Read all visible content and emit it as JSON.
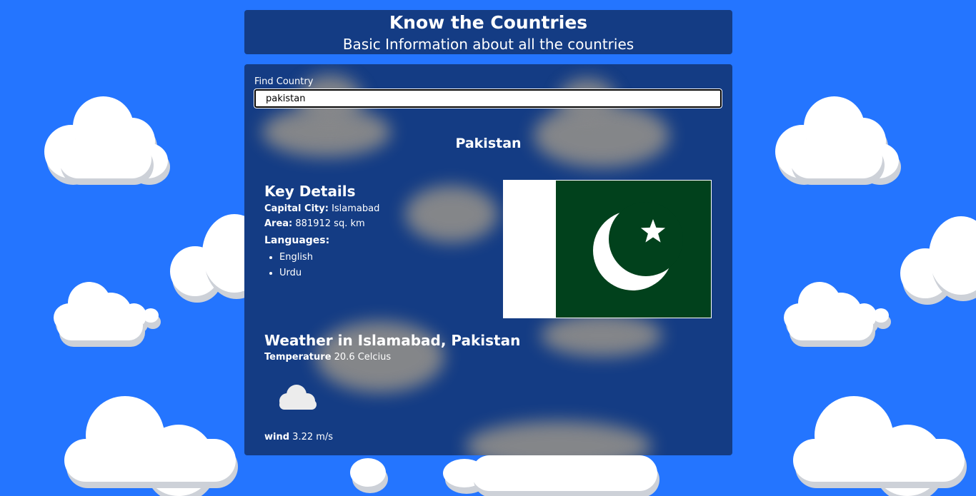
{
  "header": {
    "title": "Know the Countries",
    "subtitle": "Basic Information about all the countries"
  },
  "search": {
    "label": "Find Country",
    "value": "pakistan"
  },
  "country": {
    "name": "Pakistan",
    "key_details_title": "Key Details",
    "capital_label": "Capital City:",
    "capital": "Islamabad",
    "area_label": "Area:",
    "area": "881912 sq. km",
    "languages_title": "Languages:",
    "languages": [
      "English",
      "Urdu"
    ],
    "flag_icon": "pakistan-flag"
  },
  "weather": {
    "title": "Weather in Islamabad, Pakistan",
    "temperature_label": "Temperature",
    "temperature": "20.6 Celcius",
    "icon": "cloud-icon",
    "wind_label": "wind",
    "wind": "3.22 m/s"
  },
  "colors": {
    "page_background": "#2475ff",
    "panel_background": "#143c84",
    "flag_green": "#01411c"
  }
}
